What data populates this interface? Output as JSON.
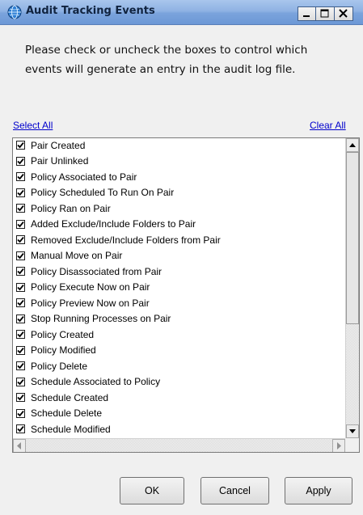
{
  "window": {
    "title": "Audit Tracking Events",
    "icon": "app-globe-icon",
    "controls": [
      "minimize-icon",
      "maximize-icon",
      "close-icon"
    ]
  },
  "instruction": {
    "line1": "Please check or uncheck the boxes to control which",
    "line2": "events will generate an entry in the audit log file."
  },
  "links": {
    "select_all": "Select All",
    "clear_all": "Clear All"
  },
  "events": [
    {
      "label": "Pair Created",
      "checked": true
    },
    {
      "label": "Pair Unlinked",
      "checked": true
    },
    {
      "label": "Policy Associated to Pair",
      "checked": true
    },
    {
      "label": "Policy Scheduled To Run On Pair",
      "checked": true
    },
    {
      "label": "Policy Ran on Pair",
      "checked": true
    },
    {
      "label": "Added Exclude/Include Folders to Pair",
      "checked": true
    },
    {
      "label": "Removed Exclude/Include Folders from Pair",
      "checked": true
    },
    {
      "label": "Manual Move on Pair",
      "checked": true
    },
    {
      "label": "Policy Disassociated from Pair",
      "checked": true
    },
    {
      "label": "Policy Execute Now on Pair",
      "checked": true
    },
    {
      "label": "Policy Preview Now on Pair",
      "checked": true
    },
    {
      "label": "Stop Running Processes on Pair",
      "checked": true
    },
    {
      "label": "Policy Created",
      "checked": true
    },
    {
      "label": "Policy Modified",
      "checked": true
    },
    {
      "label": "Policy Delete",
      "checked": true
    },
    {
      "label": "Schedule Associated to Policy",
      "checked": true
    },
    {
      "label": "Schedule Created",
      "checked": true
    },
    {
      "label": "Schedule Delete",
      "checked": true
    },
    {
      "label": "Schedule Modified",
      "checked": true
    }
  ],
  "buttons": {
    "ok": "OK",
    "cancel": "Cancel",
    "apply": "Apply"
  }
}
